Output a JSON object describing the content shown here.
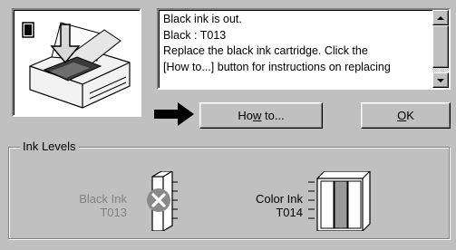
{
  "message": {
    "lines": [
      "Black ink is out.",
      "Black : T013",
      "Replace the black ink cartridge. Click the",
      "[How to...] button for instructions on replacing"
    ]
  },
  "buttons": {
    "howto": {
      "label": "How to...",
      "accel_prefix": "Ho",
      "accel_char": "w",
      "accel_suffix": " to..."
    },
    "ok": {
      "label": "OK",
      "accel_char": "O",
      "accel_suffix": "K"
    }
  },
  "ink_levels": {
    "group_title": "Ink Levels",
    "black": {
      "name": "Black Ink",
      "code": "T013",
      "status": "empty",
      "level": 0
    },
    "color": {
      "name": "Color Ink",
      "code": "T014",
      "status": "ok",
      "level": 1
    }
  },
  "colors": {
    "dialog_bg": "#c0c0c0",
    "disabled_text": "#808080",
    "error_mark": "#8a8a8a",
    "color_cartridge_fill": "#9a9a9a"
  },
  "icons": [
    "printer-icon",
    "down-arrow-icon",
    "right-arrow-icon",
    "error-x-icon",
    "scroll-up-icon",
    "scroll-down-icon"
  ]
}
